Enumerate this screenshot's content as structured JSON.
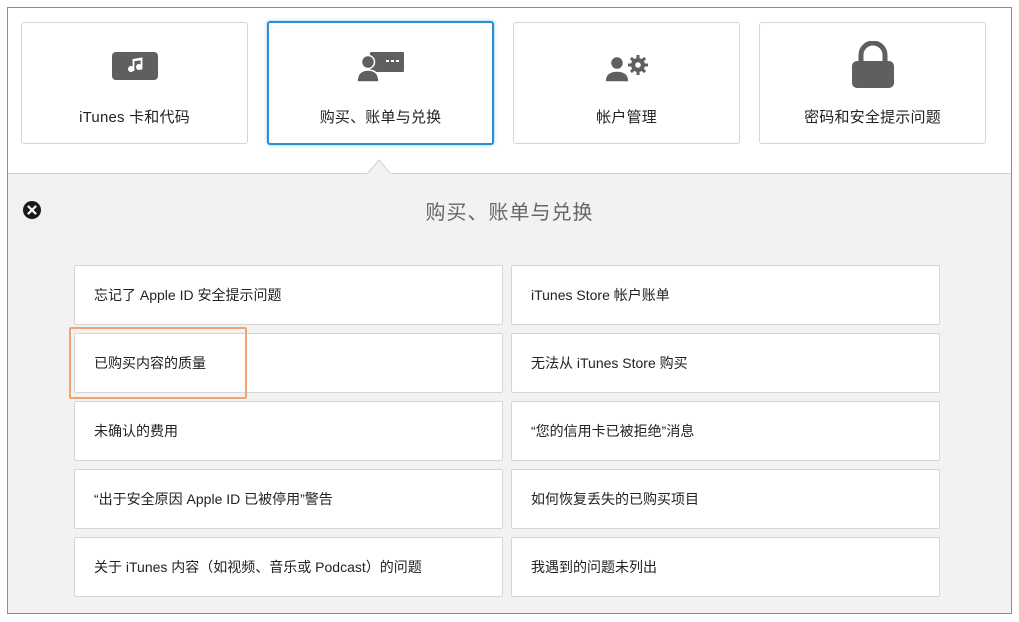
{
  "tiles": [
    {
      "label": "iTunes 卡和代码",
      "icon": "music-card-icon",
      "selected": false
    },
    {
      "label": "购买、账单与兑换",
      "icon": "purchase-billing-icon",
      "selected": true
    },
    {
      "label": "帐户管理",
      "icon": "account-gear-icon",
      "selected": false
    },
    {
      "label": "密码和安全提示问题",
      "icon": "lock-icon",
      "selected": false
    }
  ],
  "panel": {
    "title": "购买、账单与兑换",
    "close_icon": "close-icon",
    "items": [
      "忘记了 Apple ID 安全提示问题",
      "iTunes Store 帐户账单",
      "已购买内容的质量",
      "无法从 iTunes Store 购买",
      "未确认的费用",
      "“您的信用卡已被拒绝”消息",
      "“出于安全原因 Apple ID 已被停用”警告",
      "如何恢复丢失的已购买项目",
      "关于 iTunes 内容（如视频、音乐或 Podcast）的问题",
      "我遇到的问题未列出"
    ]
  },
  "colors": {
    "selected_border": "#2b8fd6",
    "highlight_border": "#f4a36f",
    "icon_gray": "#5f5f5f",
    "panel_bg": "#f2f2f2"
  }
}
